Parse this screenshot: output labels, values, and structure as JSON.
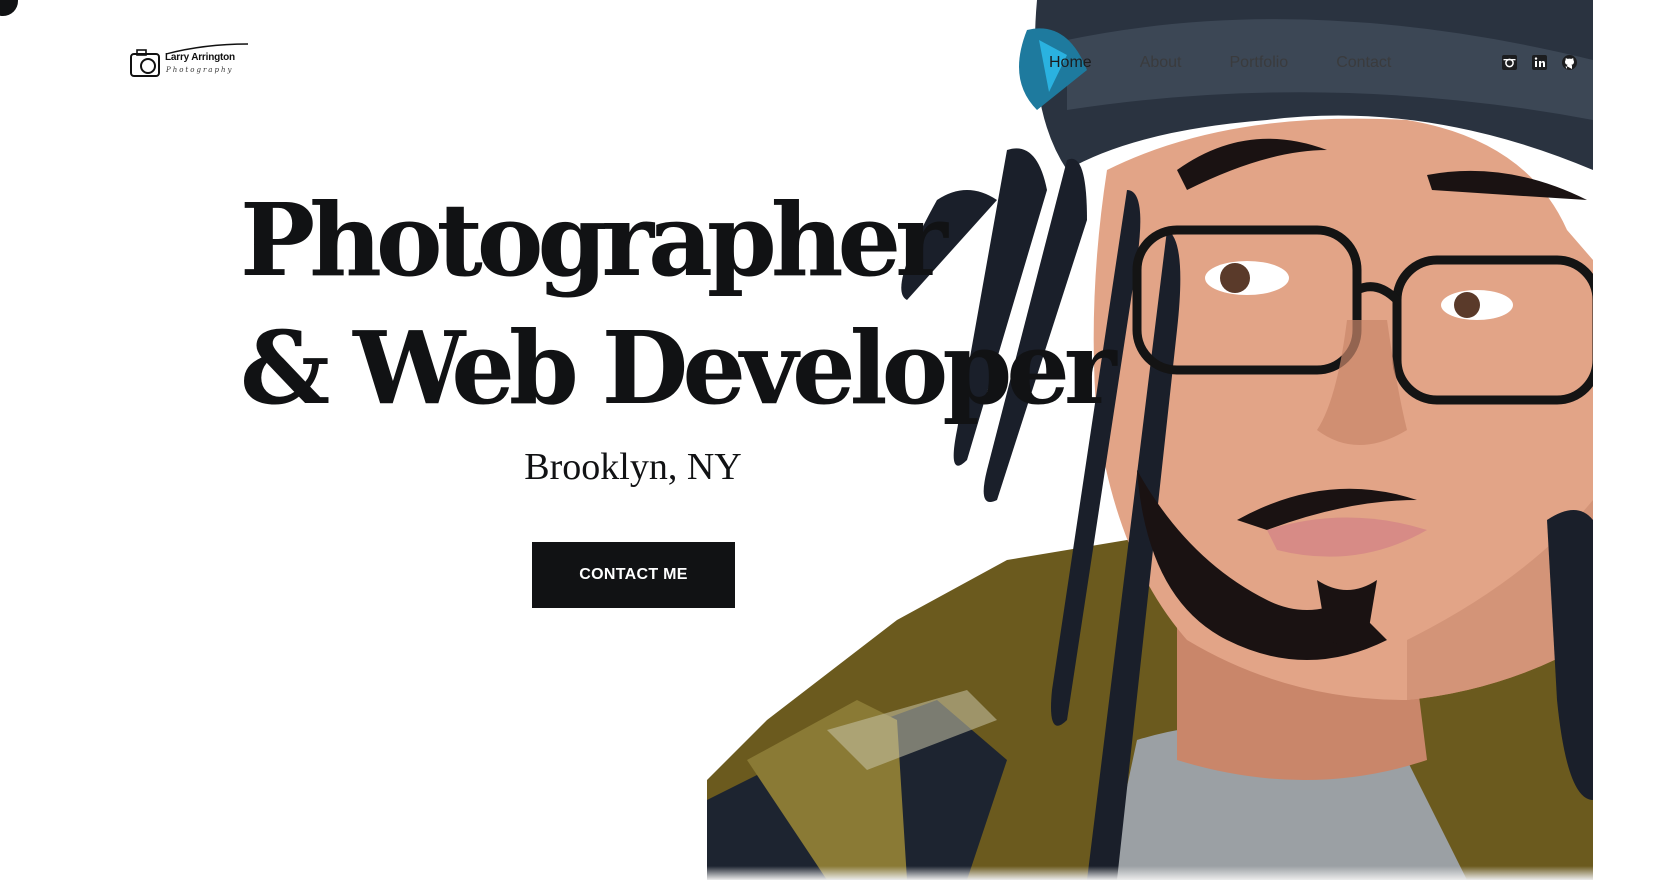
{
  "logo": {
    "name": "Larry Arrington",
    "sub": "Photography"
  },
  "nav": {
    "items": [
      "Home",
      "About",
      "Portfolio",
      "Contact"
    ],
    "active": "Home"
  },
  "social": {
    "icons": [
      "instagram-icon",
      "linkedin-icon",
      "github-icon"
    ]
  },
  "hero": {
    "title_line1": "Photographer",
    "title_line2": "& Web Developer",
    "location": "Brooklyn, NY",
    "cta_label": "CONTACT ME"
  },
  "colors": {
    "ink": "#111214",
    "nav_text": "#3a3b3d",
    "background": "#ffffff"
  }
}
